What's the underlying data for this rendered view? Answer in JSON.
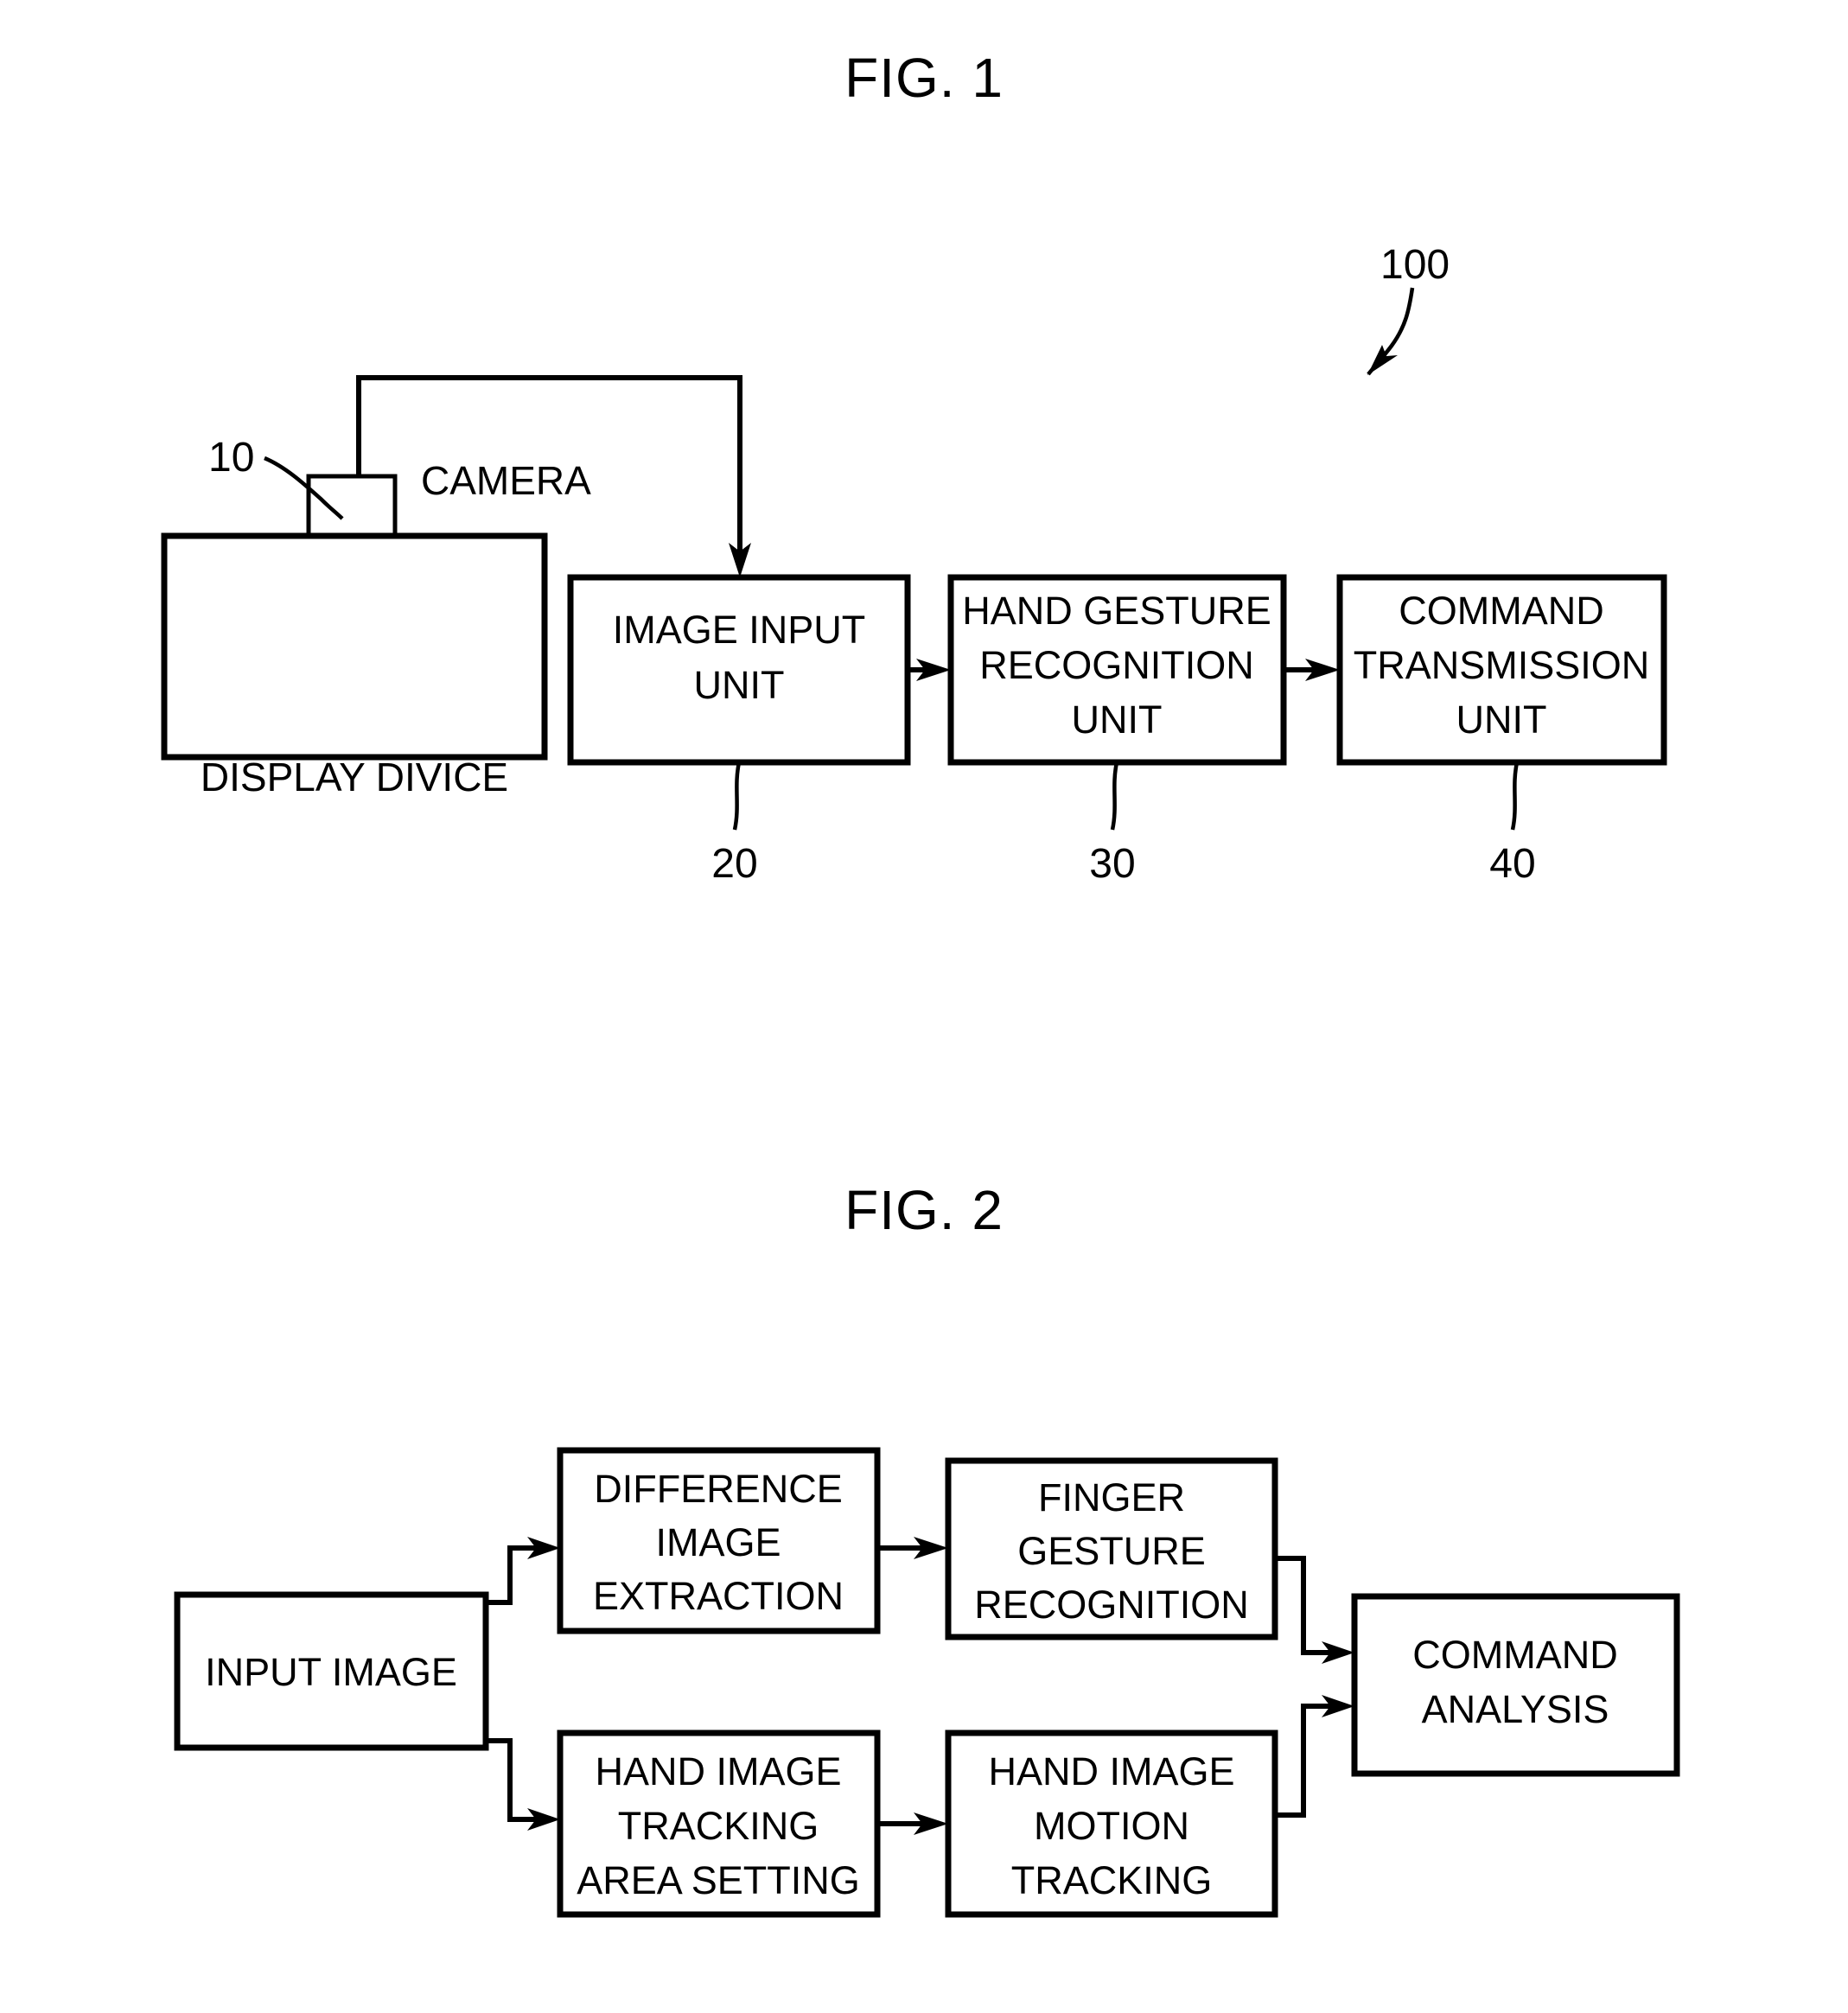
{
  "figures": [
    {
      "title": "FIG. 1",
      "reference_numerals": [
        "100",
        "10",
        "20",
        "30",
        "40"
      ],
      "blocks": [
        {
          "id": "camera_unit",
          "label": "CAMERA",
          "ref": "10"
        },
        {
          "id": "display_device",
          "label": "DISPLAY DIVICE",
          "ref": ""
        },
        {
          "id": "image_input_unit",
          "label_lines": [
            "IMAGE INPUT",
            "UNIT"
          ],
          "ref": "20"
        },
        {
          "id": "hand_gesture_recognition_unit",
          "label_lines": [
            "HAND GESTURE",
            "RECOGNITION",
            "UNIT"
          ],
          "ref": "30"
        },
        {
          "id": "command_transmission_unit",
          "label_lines": [
            "COMMAND",
            "TRANSMISSION",
            "UNIT"
          ],
          "ref": "40"
        }
      ],
      "system_ref": "100"
    },
    {
      "title": "FIG. 2",
      "reference_numerals": [],
      "blocks": [
        {
          "id": "input_image",
          "label_lines": [
            "INPUT IMAGE"
          ]
        },
        {
          "id": "difference_image_extraction",
          "label_lines": [
            "DIFFERENCE",
            "IMAGE",
            "EXTRACTION"
          ]
        },
        {
          "id": "finger_gesture_recognition",
          "label_lines": [
            "FINGER",
            "GESTURE",
            "RECOGNITION"
          ]
        },
        {
          "id": "hand_image_tracking_area_setting",
          "label_lines": [
            "HAND IMAGE",
            "TRACKING",
            "AREA SETTING"
          ]
        },
        {
          "id": "hand_image_motion_tracking",
          "label_lines": [
            "HAND IMAGE",
            "MOTION",
            "TRACKING"
          ]
        },
        {
          "id": "command_analysis",
          "label_lines": [
            "COMMAND",
            "ANALYSIS"
          ]
        }
      ]
    }
  ],
  "fig1": {
    "title": "FIG. 1",
    "system_ref": "100",
    "camera_ref": "10",
    "camera_label": "CAMERA",
    "display_label": "DISPLAY DIVICE",
    "image_input_line1": "IMAGE INPUT",
    "image_input_line2": "UNIT",
    "image_input_ref": "20",
    "hand_gesture_line1": "HAND GESTURE",
    "hand_gesture_line2": "RECOGNITION",
    "hand_gesture_line3": "UNIT",
    "hand_gesture_ref": "30",
    "command_tx_line1": "COMMAND",
    "command_tx_line2": "TRANSMISSION",
    "command_tx_line3": "UNIT",
    "command_tx_ref": "40"
  },
  "fig2": {
    "title": "FIG. 2",
    "input_image_line1": "INPUT IMAGE",
    "difference_line1": "DIFFERENCE",
    "difference_line2": "IMAGE",
    "difference_line3": "EXTRACTION",
    "finger_line1": "FINGER",
    "finger_line2": "GESTURE",
    "finger_line3": "RECOGNITION",
    "tracking_line1": "HAND IMAGE",
    "tracking_line2": "TRACKING",
    "tracking_line3": "AREA SETTING",
    "motion_line1": "HAND IMAGE",
    "motion_line2": "MOTION",
    "motion_line3": "TRACKING",
    "command_analysis_line1": "COMMAND",
    "command_analysis_line2": "ANALYSIS"
  },
  "colors": {
    "ink": "#000000",
    "paper": "#ffffff"
  }
}
